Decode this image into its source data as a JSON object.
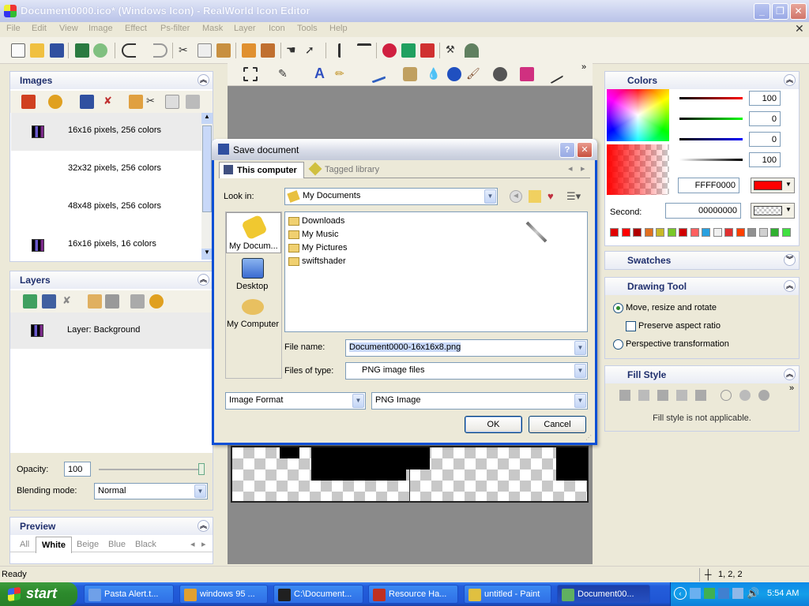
{
  "window": {
    "title": "Document0000.ico* (Windows Icon) - RealWorld Icon Editor"
  },
  "menu": [
    "File",
    "Edit",
    "View",
    "Image",
    "Effect",
    "Ps-filter",
    "Mask",
    "Layer",
    "Icon",
    "Tools",
    "Help"
  ],
  "images_panel": {
    "title": "Images",
    "items": [
      {
        "label": "16x16 pixels, 256 colors",
        "has_icon": true
      },
      {
        "label": "32x32 pixels, 256 colors",
        "has_icon": false
      },
      {
        "label": "48x48 pixels, 256 colors",
        "has_icon": false
      },
      {
        "label": "16x16 pixels, 16 colors",
        "has_icon": true
      }
    ]
  },
  "layers_panel": {
    "title": "Layers",
    "items": [
      {
        "label": "Layer: Background"
      }
    ],
    "opacity_label": "Opacity:",
    "opacity_value": "100",
    "blending_label": "Blending mode:",
    "blending_value": "Normal"
  },
  "preview_panel": {
    "title": "Preview",
    "tabs": [
      "All",
      "White",
      "Beige",
      "Blue",
      "Black"
    ],
    "selected_tab": "White"
  },
  "colors_panel": {
    "title": "Colors",
    "channel_values": [
      "100",
      "0",
      "0",
      "100"
    ],
    "hex_primary": "FFFF0000",
    "primary_color": "#ff0000",
    "second_label": "Second:",
    "hex_second": "00000000",
    "palette": [
      "#e00000",
      "#ff0000",
      "#b00000",
      "#e07020",
      "#c8b828",
      "#78c828",
      "#d00000",
      "#ff6060",
      "#28a0e0",
      "#f0f0f0",
      "#e03030",
      "#ff4000",
      "#909090",
      "#d0d0d0",
      "#30b030",
      "#40e040"
    ]
  },
  "swatches_panel": {
    "title": "Swatches"
  },
  "drawing_tool_panel": {
    "title": "Drawing Tool",
    "options": [
      {
        "label": "Move, resize and rotate",
        "type": "radio",
        "checked": true
      },
      {
        "label": "Preserve aspect ratio",
        "type": "checkbox",
        "checked": false
      },
      {
        "label": "Perspective transformation",
        "type": "radio",
        "checked": false
      }
    ]
  },
  "fill_style_panel": {
    "title": "Fill Style",
    "message": "Fill style is not applicable."
  },
  "dialog": {
    "title": "Save document",
    "tabs": [
      "This computer",
      "Tagged library"
    ],
    "look_in_label": "Look in:",
    "look_in_value": "My Documents",
    "places": [
      "My Docum...",
      "Desktop",
      "My Computer"
    ],
    "folders": [
      "Downloads",
      "My Music",
      "My Pictures",
      "swiftshader"
    ],
    "file_name_label": "File name:",
    "file_name_value": "Document0000-16x16x8.png",
    "files_of_type_label": "Files of type:",
    "files_of_type_value": "PNG image files",
    "format_left": "Image Format",
    "format_right": "PNG Image",
    "ok_label": "OK",
    "cancel_label": "Cancel"
  },
  "status": {
    "text": "Ready",
    "coords": "1, 2, 2"
  },
  "taskbar": {
    "start_label": "start",
    "tasks": [
      {
        "label": "Pasta Alert.t...",
        "color": "#6fa0e8"
      },
      {
        "label": "windows 95 ...",
        "color": "#e0a030"
      },
      {
        "label": "C:\\Document...",
        "color": "#202020"
      },
      {
        "label": "Resource Ha...",
        "color": "#c03020"
      },
      {
        "label": "untitled - Paint",
        "color": "#e0c040"
      },
      {
        "label": "Document00...",
        "color": "#60b060"
      }
    ],
    "active_task": 5,
    "clock": "5:54 AM"
  }
}
